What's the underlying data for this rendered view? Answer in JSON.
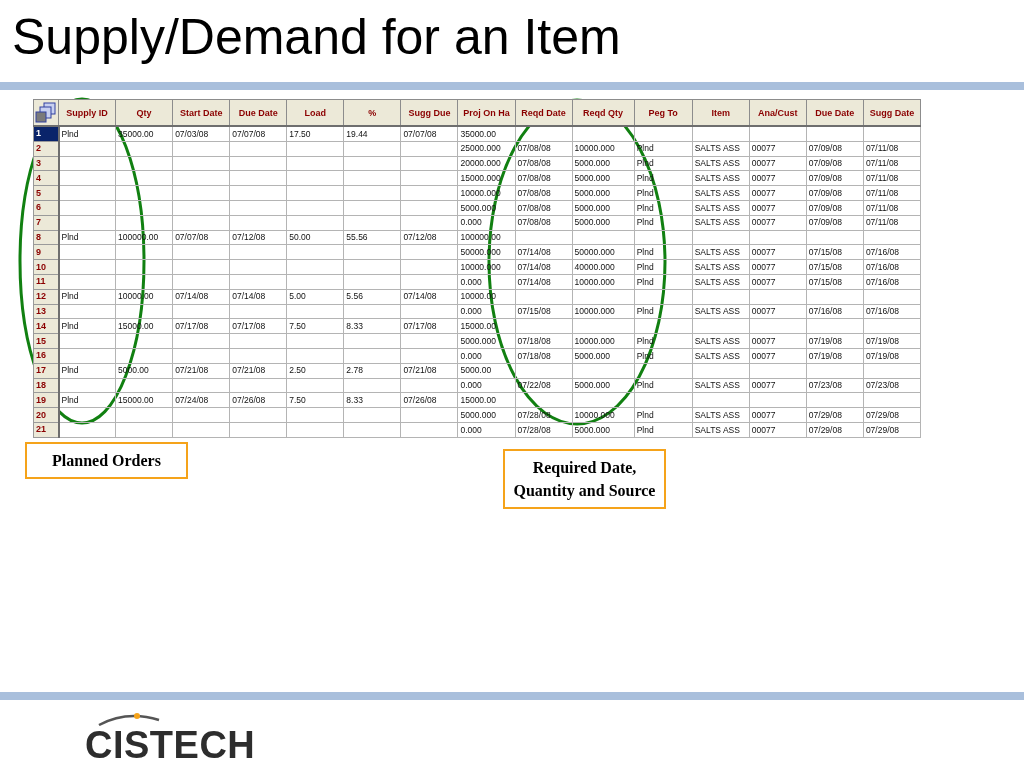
{
  "title": "Supply/Demand for an Item",
  "table": {
    "columns": [
      "Supply ID",
      "Qty",
      "Start Date",
      "Due Date",
      "Load",
      "%",
      "Sugg Due",
      "Proj On Ha",
      "Reqd Date",
      "Reqd Qty",
      "Peg To",
      "Item",
      "Ana/Cust",
      "Due Date",
      "Sugg Date"
    ],
    "rows": [
      {
        "number": "1",
        "selected": true,
        "cells": [
          "Plnd",
          "35000.00",
          "07/03/08",
          "07/07/08",
          "17.50",
          "19.44",
          "07/07/08",
          "35000.00",
          null,
          null,
          null,
          null,
          null,
          null,
          null
        ]
      },
      {
        "number": "2",
        "selected": false,
        "cells": [
          null,
          null,
          null,
          null,
          null,
          null,
          null,
          "25000.000",
          "07/08/08",
          "10000.000",
          "Plnd",
          "SALTS ASS",
          "00077",
          "07/09/08",
          "07/11/08"
        ]
      },
      {
        "number": "3",
        "selected": false,
        "cells": [
          null,
          null,
          null,
          null,
          null,
          null,
          null,
          "20000.000",
          "07/08/08",
          "5000.000",
          "Plnd",
          "SALTS ASS",
          "00077",
          "07/09/08",
          "07/11/08"
        ]
      },
      {
        "number": "4",
        "selected": false,
        "cells": [
          null,
          null,
          null,
          null,
          null,
          null,
          null,
          "15000.000",
          "07/08/08",
          "5000.000",
          "Plnd",
          "SALTS ASS",
          "00077",
          "07/09/08",
          "07/11/08"
        ]
      },
      {
        "number": "5",
        "selected": false,
        "cells": [
          null,
          null,
          null,
          null,
          null,
          null,
          null,
          "10000.000",
          "07/08/08",
          "5000.000",
          "Plnd",
          "SALTS ASS",
          "00077",
          "07/09/08",
          "07/11/08"
        ]
      },
      {
        "number": "6",
        "selected": false,
        "cells": [
          null,
          null,
          null,
          null,
          null,
          null,
          null,
          "5000.000",
          "07/08/08",
          "5000.000",
          "Plnd",
          "SALTS ASS",
          "00077",
          "07/09/08",
          "07/11/08"
        ]
      },
      {
        "number": "7",
        "selected": false,
        "cells": [
          null,
          null,
          null,
          null,
          null,
          null,
          null,
          "0.000",
          "07/08/08",
          "5000.000",
          "Plnd",
          "SALTS ASS",
          "00077",
          "07/09/08",
          "07/11/08"
        ]
      },
      {
        "number": "8",
        "selected": false,
        "cells": [
          "Plnd",
          "100000.00",
          "07/07/08",
          "07/12/08",
          "50.00",
          "55.56",
          "07/12/08",
          "100000.00",
          null,
          null,
          null,
          null,
          null,
          null,
          null
        ]
      },
      {
        "number": "9",
        "selected": false,
        "cells": [
          null,
          null,
          null,
          null,
          null,
          null,
          null,
          "50000.000",
          "07/14/08",
          "50000.000",
          "Plnd",
          "SALTS ASS",
          "00077",
          "07/15/08",
          "07/16/08"
        ]
      },
      {
        "number": "10",
        "selected": false,
        "cells": [
          null,
          null,
          null,
          null,
          null,
          null,
          null,
          "10000.000",
          "07/14/08",
          "40000.000",
          "Plnd",
          "SALTS ASS",
          "00077",
          "07/15/08",
          "07/16/08"
        ]
      },
      {
        "number": "11",
        "selected": false,
        "cells": [
          null,
          null,
          null,
          null,
          null,
          null,
          null,
          "0.000",
          "07/14/08",
          "10000.000",
          "Plnd",
          "SALTS ASS",
          "00077",
          "07/15/08",
          "07/16/08"
        ]
      },
      {
        "number": "12",
        "selected": false,
        "cells": [
          "Plnd",
          "10000.00",
          "07/14/08",
          "07/14/08",
          "5.00",
          "5.56",
          "07/14/08",
          "10000.00",
          null,
          null,
          null,
          null,
          null,
          null,
          null
        ]
      },
      {
        "number": "13",
        "selected": false,
        "cells": [
          null,
          null,
          null,
          null,
          null,
          null,
          null,
          "0.000",
          "07/15/08",
          "10000.000",
          "Plnd",
          "SALTS ASS",
          "00077",
          "07/16/08",
          "07/16/08"
        ]
      },
      {
        "number": "14",
        "selected": false,
        "cells": [
          "Plnd",
          "15000.00",
          "07/17/08",
          "07/17/08",
          "7.50",
          "8.33",
          "07/17/08",
          "15000.00",
          null,
          null,
          null,
          null,
          null,
          null,
          null
        ]
      },
      {
        "number": "15",
        "selected": false,
        "cells": [
          null,
          null,
          null,
          null,
          null,
          null,
          null,
          "5000.000",
          "07/18/08",
          "10000.000",
          "Plnd",
          "SALTS ASS",
          "00077",
          "07/19/08",
          "07/19/08"
        ]
      },
      {
        "number": "16",
        "selected": false,
        "cells": [
          null,
          null,
          null,
          null,
          null,
          null,
          null,
          "0.000",
          "07/18/08",
          "5000.000",
          "Plnd",
          "SALTS ASS",
          "00077",
          "07/19/08",
          "07/19/08"
        ]
      },
      {
        "number": "17",
        "selected": false,
        "cells": [
          "Plnd",
          "5000.00",
          "07/21/08",
          "07/21/08",
          "2.50",
          "2.78",
          "07/21/08",
          "5000.00",
          null,
          null,
          null,
          null,
          null,
          null,
          null
        ]
      },
      {
        "number": "18",
        "selected": false,
        "cells": [
          null,
          null,
          null,
          null,
          null,
          null,
          null,
          "0.000",
          "07/22/08",
          "5000.000",
          "Plnd",
          "SALTS ASS",
          "00077",
          "07/23/08",
          "07/23/08"
        ]
      },
      {
        "number": "19",
        "selected": false,
        "cells": [
          "Plnd",
          "15000.00",
          "07/24/08",
          "07/26/08",
          "7.50",
          "8.33",
          "07/26/08",
          "15000.00",
          null,
          null,
          null,
          null,
          null,
          null,
          null
        ]
      },
      {
        "number": "20",
        "selected": false,
        "cells": [
          null,
          null,
          null,
          null,
          null,
          null,
          null,
          "5000.000",
          "07/28/08",
          "10000.000",
          "Plnd",
          "SALTS ASS",
          "00077",
          "07/29/08",
          "07/29/08"
        ]
      },
      {
        "number": "21",
        "selected": false,
        "cells": [
          null,
          null,
          null,
          null,
          null,
          null,
          null,
          "0.000",
          "07/28/08",
          "5000.000",
          "Plnd",
          "SALTS ASS",
          "00077",
          "07/29/08",
          "07/29/08"
        ]
      }
    ]
  },
  "callouts": [
    {
      "text": "Planned Orders"
    },
    {
      "text": "Required Date, Quantity and Source"
    }
  ],
  "logo": {
    "text": "CISTECH"
  }
}
